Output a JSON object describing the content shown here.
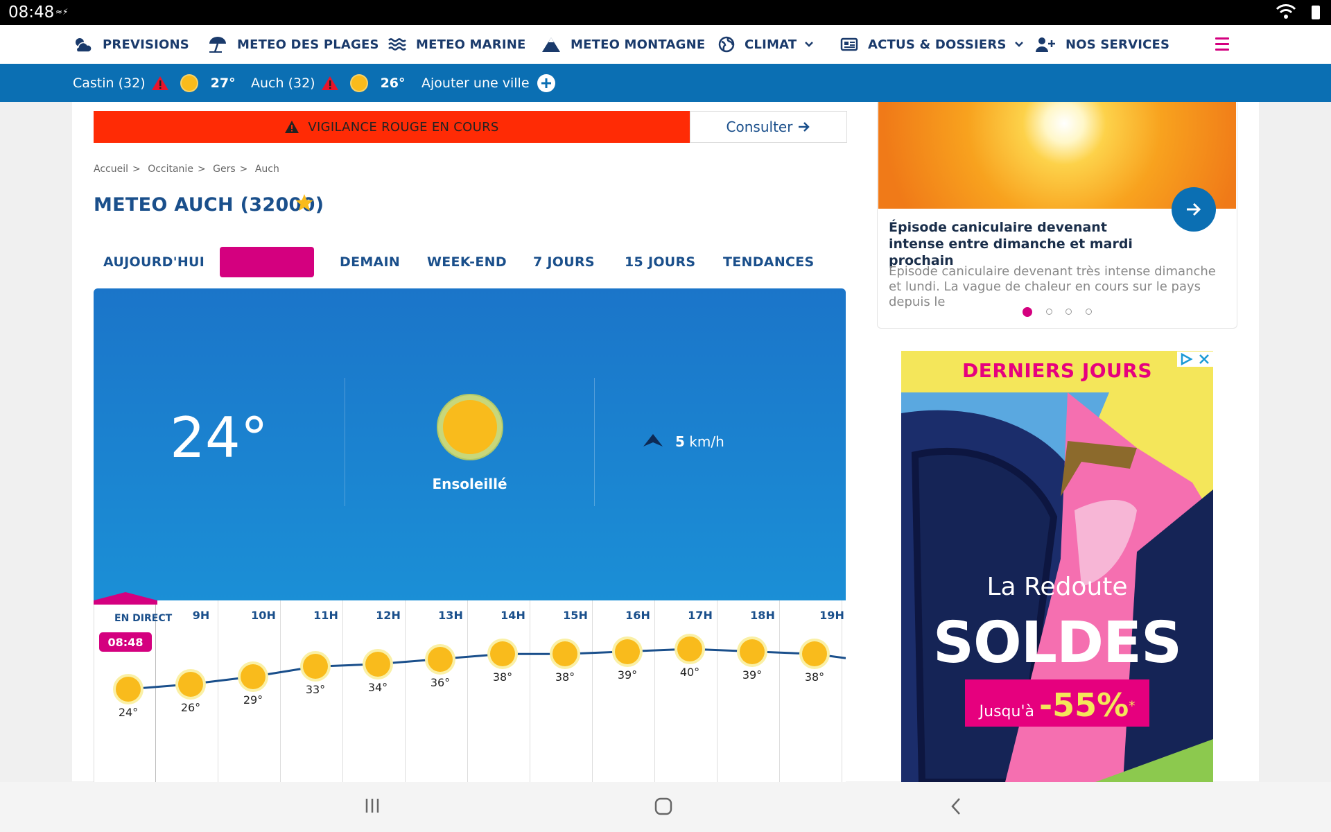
{
  "status_bar": {
    "time": "08:48"
  },
  "nav": {
    "items": [
      {
        "label": "PREVISIONS"
      },
      {
        "label": "METEO DES PLAGES"
      },
      {
        "label": "METEO MARINE"
      },
      {
        "label": "METEO MONTAGNE"
      },
      {
        "label": "CLIMAT"
      },
      {
        "label": "ACTUS & DOSSIERS"
      },
      {
        "label": "NOS SERVICES"
      }
    ]
  },
  "city_bar": {
    "cities": [
      {
        "name": "Castin (32)",
        "temp": "27°"
      },
      {
        "name": "Auch (32)",
        "temp": "26°"
      }
    ],
    "add_label": "Ajouter une ville"
  },
  "vigilance": {
    "label": "VIGILANCE ROUGE EN COURS",
    "button": "Consulter",
    "color": "#ff2b05"
  },
  "breadcrumb": [
    "Accueil",
    "Occitanie",
    "Gers",
    "Auch"
  ],
  "page_title": "METEO AUCH (32000)",
  "tabs": [
    {
      "label": "AUJOURD'HUI"
    },
    {
      "label": ""
    },
    {
      "label": "DEMAIN"
    },
    {
      "label": "WEEK-END"
    },
    {
      "label": "7 JOURS"
    },
    {
      "label": "15 JOURS"
    },
    {
      "label": "TENDANCES"
    }
  ],
  "current": {
    "temp": "24°",
    "condition": "Ensoleillé",
    "wind_value": "5",
    "wind_unit": "km/h"
  },
  "hourly": {
    "live_label": "EN DIRECT",
    "live_time": "08:48",
    "hours": [
      "",
      "9H",
      "10H",
      "11H",
      "12H",
      "13H",
      "14H",
      "15H",
      "16H",
      "17H",
      "18H",
      "19H"
    ],
    "temps": [
      "24°",
      "26°",
      "29°",
      "33°",
      "34°",
      "36°",
      "38°",
      "38°",
      "39°",
      "40°",
      "39°",
      "38°"
    ]
  },
  "news": {
    "title": "Épisode caniculaire devenant intense entre dimanche et mardi prochain",
    "text": "Episode caniculaire devenant très intense dimanche et lundi. La vague de chaleur en cours sur le pays depuis le"
  },
  "ad": {
    "header": "DERNIERS JOURS",
    "brand": "La Redoute",
    "headline": "SOLDES",
    "promo_prefix": "Jusqu'à",
    "promo_value": "-55%",
    "promo_star": "*"
  },
  "colors": {
    "accent": "#d4007f",
    "nav_text": "#1a3a6b",
    "city_bar": "#0b6fb3",
    "sun": "#f9bb1c"
  }
}
